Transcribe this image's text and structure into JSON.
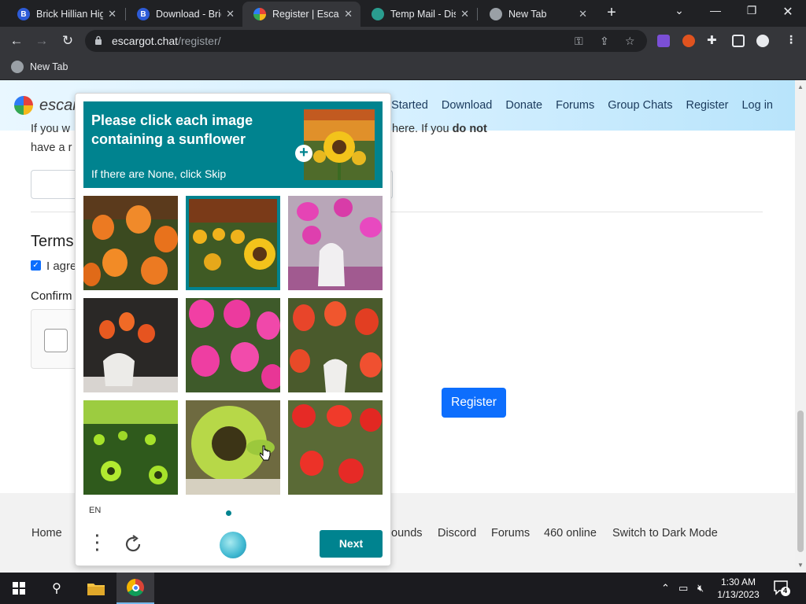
{
  "browser": {
    "tabs": [
      {
        "title": "Brick Hillian Hig",
        "favicon_color": "#2d5bd7",
        "favicon_letter": "B"
      },
      {
        "title": "Download - Bric",
        "favicon_color": "#2d5bd7",
        "favicon_letter": "B"
      },
      {
        "title": "Register | Escarg",
        "favicon_color": "#f6b71a",
        "favicon_letter": "",
        "active": true
      },
      {
        "title": "Temp Mail - Disp",
        "favicon_color": "#2a9d8f",
        "favicon_letter": ""
      },
      {
        "title": "New Tab",
        "favicon_color": "#9aa0a6",
        "favicon_letter": ""
      }
    ],
    "url_domain": "escargot.chat",
    "url_path": "/register/",
    "bookmark_label": "New Tab"
  },
  "site": {
    "logo_text": "escarg",
    "nav": [
      "et Started",
      "Download",
      "Donate",
      "Forums",
      "Group Chats",
      "Register",
      "Log in"
    ],
    "line1_left": "If you w",
    "line1_right": "here. If you",
    "line1_bold": "do not",
    "line2_left": "have a r",
    "terms_heading": "Terms",
    "agree_label": "I agre",
    "confirm_label": "Confirm",
    "register_button": "Register",
    "footer_links": [
      "Home",
      "ounds",
      "Discord",
      "Forums",
      "460 online",
      "Switch to Dark Mode"
    ]
  },
  "captcha": {
    "prompt_title": "Please click each image containing a sunflower",
    "prompt_subtitle": "If there are None, click Skip",
    "language": "EN",
    "next_button": "Next",
    "tiles": [
      {
        "subject": "orange tulips",
        "selected": false
      },
      {
        "subject": "sunflower field at sunset",
        "selected": true
      },
      {
        "subject": "pink tulips in white vase",
        "selected": false
      },
      {
        "subject": "orange tulips in white vase",
        "selected": false
      },
      {
        "subject": "pink tulips",
        "selected": false
      },
      {
        "subject": "red tulips in vase",
        "selected": false
      },
      {
        "subject": "sunflower field",
        "selected": false
      },
      {
        "subject": "single sunflower closeup",
        "selected": false
      },
      {
        "subject": "red tulips",
        "selected": false
      }
    ]
  },
  "taskbar": {
    "time": "1:30 AM",
    "date": "1/13/2023",
    "notification_count": "4"
  },
  "colors": {
    "captcha_teal": "#00838f",
    "register_blue": "#0d6efd"
  }
}
